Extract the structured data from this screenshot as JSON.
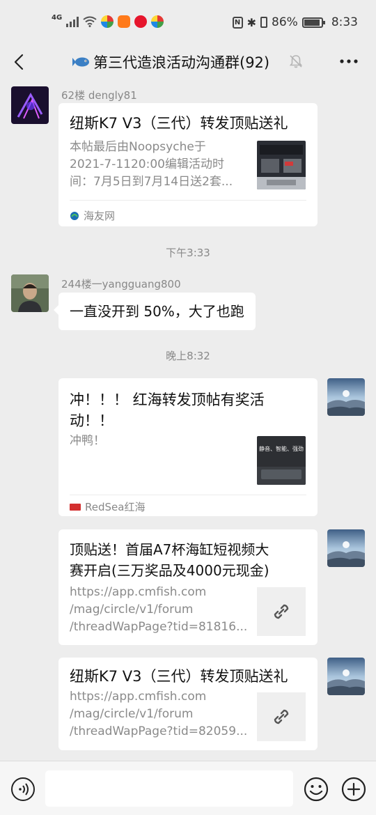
{
  "status_bar": {
    "network": "4G",
    "battery": "86%",
    "battery_level": 0.86,
    "time": "8:33"
  },
  "nav": {
    "title": "第三代造浪活动沟通群(92)",
    "icons": [
      "back-icon",
      "fish-icon",
      "mute-icon",
      "more-icon"
    ]
  },
  "messages": {
    "m1": {
      "sender": "62楼 dengly81",
      "title": "纽斯K7 V3（三代）转发顶贴送礼",
      "desc": [
        "本帖最后由Noopsyche于",
        "2021-7-1120:00编辑活动时",
        "间：7月5日到7月14日送2套..."
      ],
      "source": "海友网"
    },
    "t1": "下午3:33",
    "m2": {
      "sender": "244楼一yangguang800",
      "text": "一直没开到 50%，大了也跑"
    },
    "t2": "晚上8:32",
    "m3": {
      "title": [
        "冲！！！ 红海转发顶帖有奖活",
        "动！！"
      ],
      "desc": "冲鸭！",
      "thumb_text": "静音、智能、强劲",
      "source": "RedSea红海"
    },
    "m4": {
      "title": [
        "顶贴送！首届A7杯海缸短视频大",
        "赛开启(三万奖品及4000元现金)"
      ],
      "desc": [
        "https://app.cmfish.com",
        "/mag/circle/v1/forum",
        "/threadWapPage?tid=81816..."
      ]
    },
    "m5": {
      "title": "纽斯K7 V3（三代）转发顶贴送礼",
      "desc": [
        "https://app.cmfish.com",
        "/mag/circle/v1/forum",
        "/threadWapPage?tid=82059..."
      ]
    }
  },
  "input_bar": {
    "placeholder": ""
  }
}
